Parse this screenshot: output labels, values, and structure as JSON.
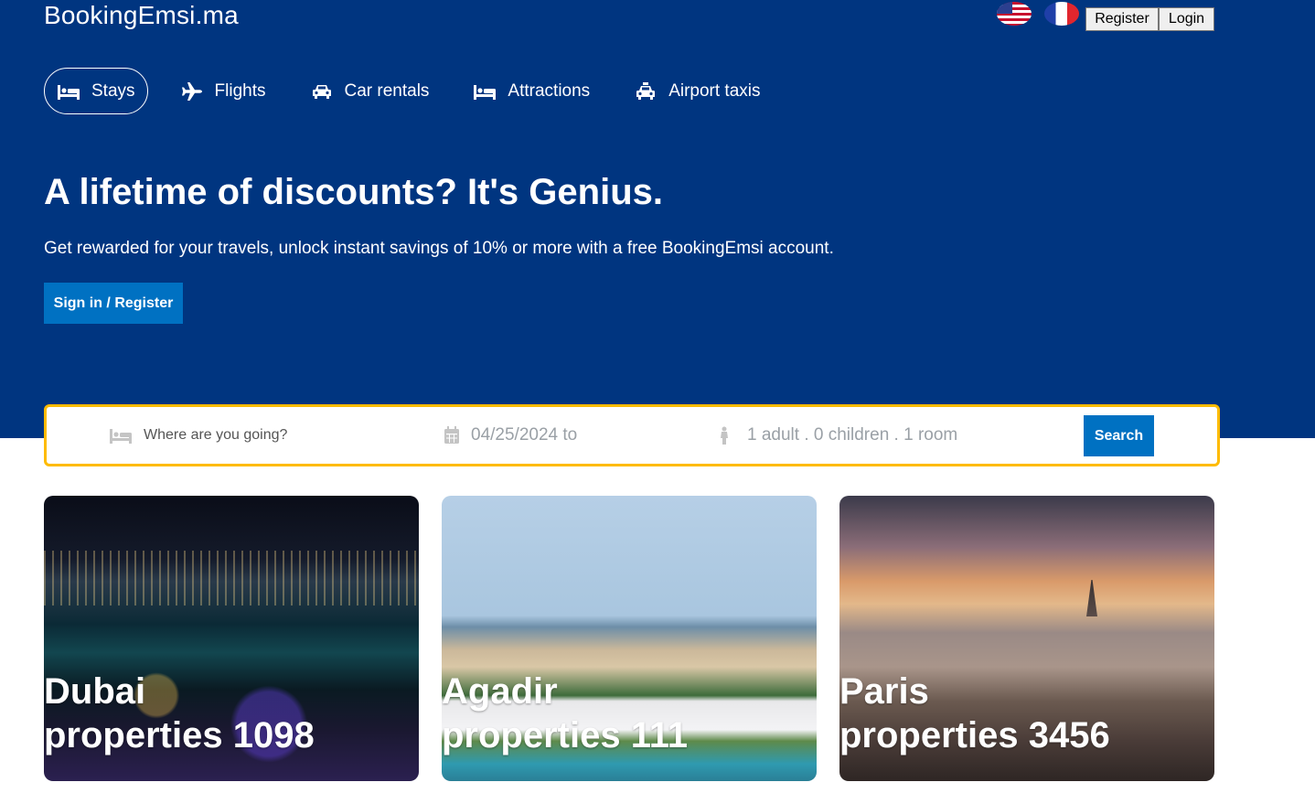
{
  "header": {
    "brand": "BookingEmsi.ma",
    "register_label": "Register",
    "login_label": "Login"
  },
  "nav": {
    "items": [
      {
        "label": "Stays",
        "icon": "bed-icon",
        "active": true
      },
      {
        "label": "Flights",
        "icon": "plane-icon",
        "active": false
      },
      {
        "label": "Car rentals",
        "icon": "car-icon",
        "active": false
      },
      {
        "label": "Attractions",
        "icon": "bed-icon",
        "active": false
      },
      {
        "label": "Airport taxis",
        "icon": "taxi-icon",
        "active": false
      }
    ]
  },
  "hero": {
    "title": "A lifetime of discounts? It's Genius.",
    "subtitle": "Get rewarded for your travels, unlock instant savings of 10% or more with a free BookingEmsi account.",
    "cta_label": "Sign in / Register"
  },
  "search": {
    "destination_placeholder": "Where are you going?",
    "date_placeholder": "04/25/2024 to",
    "guests_placeholder": "1 adult . 0 children . 1 room",
    "button_label": "Search"
  },
  "destinations": [
    {
      "city": "Dubai",
      "properties": "properties 1098"
    },
    {
      "city": "Agadir",
      "properties": "properties 111"
    },
    {
      "city": "Paris",
      "properties": "properties 3456"
    }
  ],
  "colors": {
    "hero_bg": "#003580",
    "accent_blue": "#0071c2",
    "search_border": "#febb02"
  }
}
